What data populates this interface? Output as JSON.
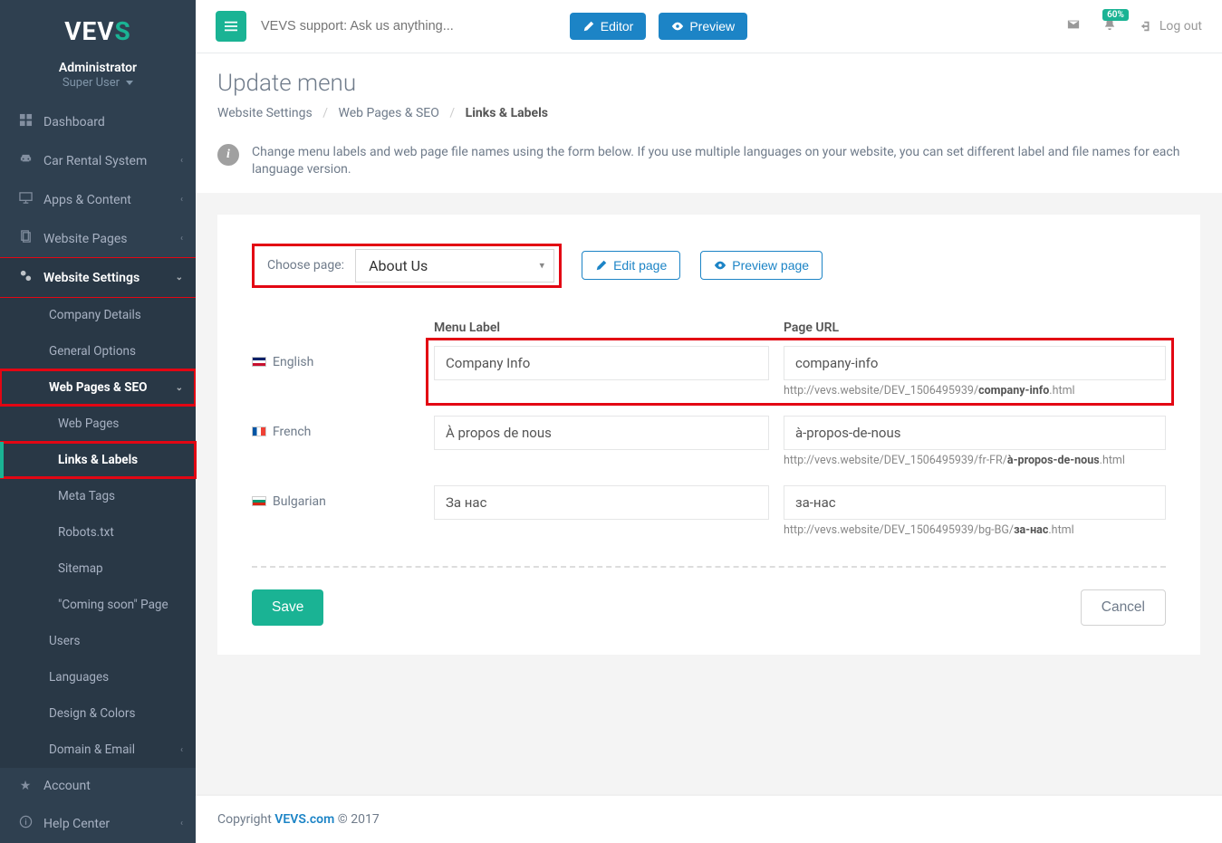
{
  "brand": {
    "main": "VEV",
    "accent": "S"
  },
  "user": {
    "role": "Administrator",
    "level": "Super User"
  },
  "topbar": {
    "search_placeholder": "VEVS support: Ask us anything...",
    "editor": "Editor",
    "preview": "Preview",
    "badge": "60%",
    "logout": "Log out"
  },
  "sidebar": {
    "items": [
      {
        "label": "Dashboard"
      },
      {
        "label": "Car Rental System"
      },
      {
        "label": "Apps & Content"
      },
      {
        "label": "Website Pages"
      },
      {
        "label": "Website Settings"
      }
    ],
    "settings_children": [
      {
        "label": "Company Details"
      },
      {
        "label": "General Options"
      },
      {
        "label": "Web Pages & SEO"
      }
    ],
    "seo_children": [
      {
        "label": "Web Pages"
      },
      {
        "label": "Links & Labels"
      },
      {
        "label": "Meta Tags"
      },
      {
        "label": "Robots.txt"
      },
      {
        "label": "Sitemap"
      },
      {
        "label": "\"Coming soon\" Page"
      }
    ],
    "settings_rest": [
      {
        "label": "Users"
      },
      {
        "label": "Languages"
      },
      {
        "label": "Design & Colors"
      },
      {
        "label": "Domain & Email"
      }
    ],
    "bottom": [
      {
        "label": "Account"
      },
      {
        "label": "Help Center"
      }
    ]
  },
  "page": {
    "title": "Update menu",
    "breadcrumb": [
      "Website Settings",
      "Web Pages & SEO",
      "Links & Labels"
    ],
    "info": "Change menu labels and web page file names using the form below. If you use multiple languages on your website, you can set different label and file names for each language version.",
    "choose_label": "Choose page:",
    "choose_value": "About Us",
    "edit_page": "Edit page",
    "preview_page": "Preview page",
    "th_menu": "Menu Label",
    "th_url": "Page URL",
    "rows": [
      {
        "lang": "English",
        "label": "Company Info",
        "slug": "company-info",
        "url_prefix": "http://vevs.website/DEV_1506495939/",
        "url_bold": "company-info",
        "url_suffix": ".html"
      },
      {
        "lang": "French",
        "label": "À propos de nous",
        "slug": "à-propos-de-nous",
        "url_prefix": "http://vevs.website/DEV_1506495939/fr-FR/",
        "url_bold": "à-propos-de-nous",
        "url_suffix": ".html"
      },
      {
        "lang": "Bulgarian",
        "label": "За нас",
        "slug": "за-нас",
        "url_prefix": "http://vevs.website/DEV_1506495939/bg-BG/",
        "url_bold": "за-нас",
        "url_suffix": ".html"
      }
    ],
    "save": "Save",
    "cancel": "Cancel"
  },
  "footer": {
    "copyright": "Copyright ",
    "link": "VEVS.com",
    "year": " © 2017"
  }
}
